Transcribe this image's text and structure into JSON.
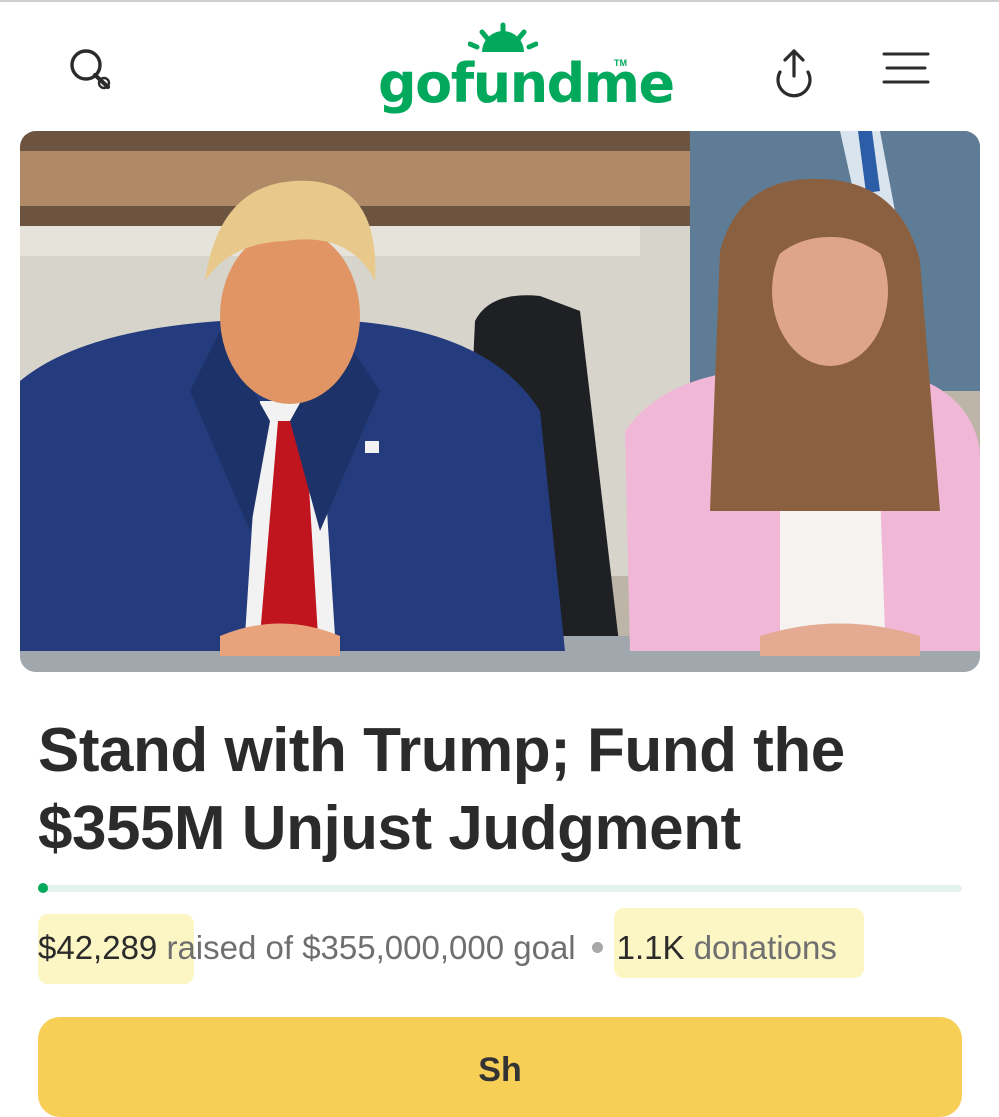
{
  "header": {
    "logo_text": "gofundme",
    "logo_tm": "TM",
    "icons": [
      "search-icon",
      "share-icon",
      "menu-icon"
    ]
  },
  "hero": {
    "image": "photo-two-people-seated-in-courtroom"
  },
  "campaign": {
    "title": "Stand with Trump; Fund the $355M Unjust Judgment",
    "progress_fraction": 0.000119,
    "raised_amount": "$42,289",
    "raised_text": " raised of $355,000,000 goal",
    "donation_count": "1.1K",
    "donation_label": " donations"
  },
  "cta": {
    "share_label": "Sh"
  },
  "colors": {
    "brand_green": "#02a95c",
    "progress_track": "#e3f2ea",
    "cta_yellow": "#f8cf56",
    "highlight": "#fbf6c4",
    "text_dark": "#2b2b2b",
    "text_muted": "#6f6f6f"
  }
}
